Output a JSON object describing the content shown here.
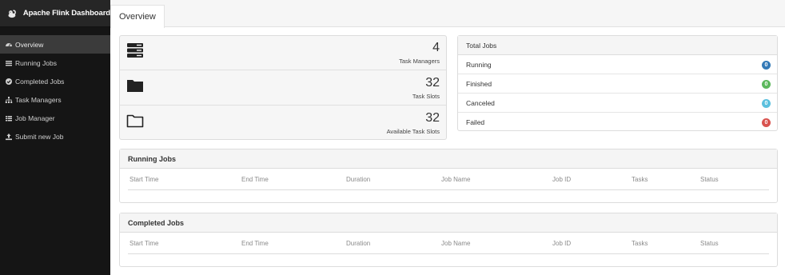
{
  "app": {
    "title": "Apache Flink Dashboard"
  },
  "sidebar": {
    "items": [
      {
        "label": "Overview",
        "icon": "dashboard-icon",
        "active": true
      },
      {
        "label": "Running Jobs",
        "icon": "list-icon",
        "active": false
      },
      {
        "label": "Completed Jobs",
        "icon": "check-circle-icon",
        "active": false
      },
      {
        "label": "Task Managers",
        "icon": "sitemap-icon",
        "active": false
      },
      {
        "label": "Job Manager",
        "icon": "tasks-icon",
        "active": false
      },
      {
        "label": "Submit new Job",
        "icon": "upload-icon",
        "active": false
      }
    ]
  },
  "topbar": {
    "tab_label": "Overview"
  },
  "stats": [
    {
      "value": "4",
      "label": "Task Managers",
      "icon": "server-icon"
    },
    {
      "value": "32",
      "label": "Task Slots",
      "icon": "folder-filled-icon"
    },
    {
      "value": "32",
      "label": "Available Task Slots",
      "icon": "folder-open-icon"
    }
  ],
  "jobs_summary": {
    "title": "Total Jobs",
    "rows": [
      {
        "label": "Running",
        "count": "0",
        "color": "#337ab7"
      },
      {
        "label": "Finished",
        "count": "0",
        "color": "#5cb85c"
      },
      {
        "label": "Canceled",
        "count": "0",
        "color": "#5bc0de"
      },
      {
        "label": "Failed",
        "count": "0",
        "color": "#d9534f"
      }
    ]
  },
  "running_jobs": {
    "title": "Running Jobs",
    "columns": [
      "Start Time",
      "End Time",
      "Duration",
      "Job Name",
      "Job ID",
      "Tasks",
      "Status"
    ]
  },
  "completed_jobs": {
    "title": "Completed Jobs",
    "columns": [
      "Start Time",
      "End Time",
      "Duration",
      "Job Name",
      "Job ID",
      "Tasks",
      "Status"
    ]
  }
}
